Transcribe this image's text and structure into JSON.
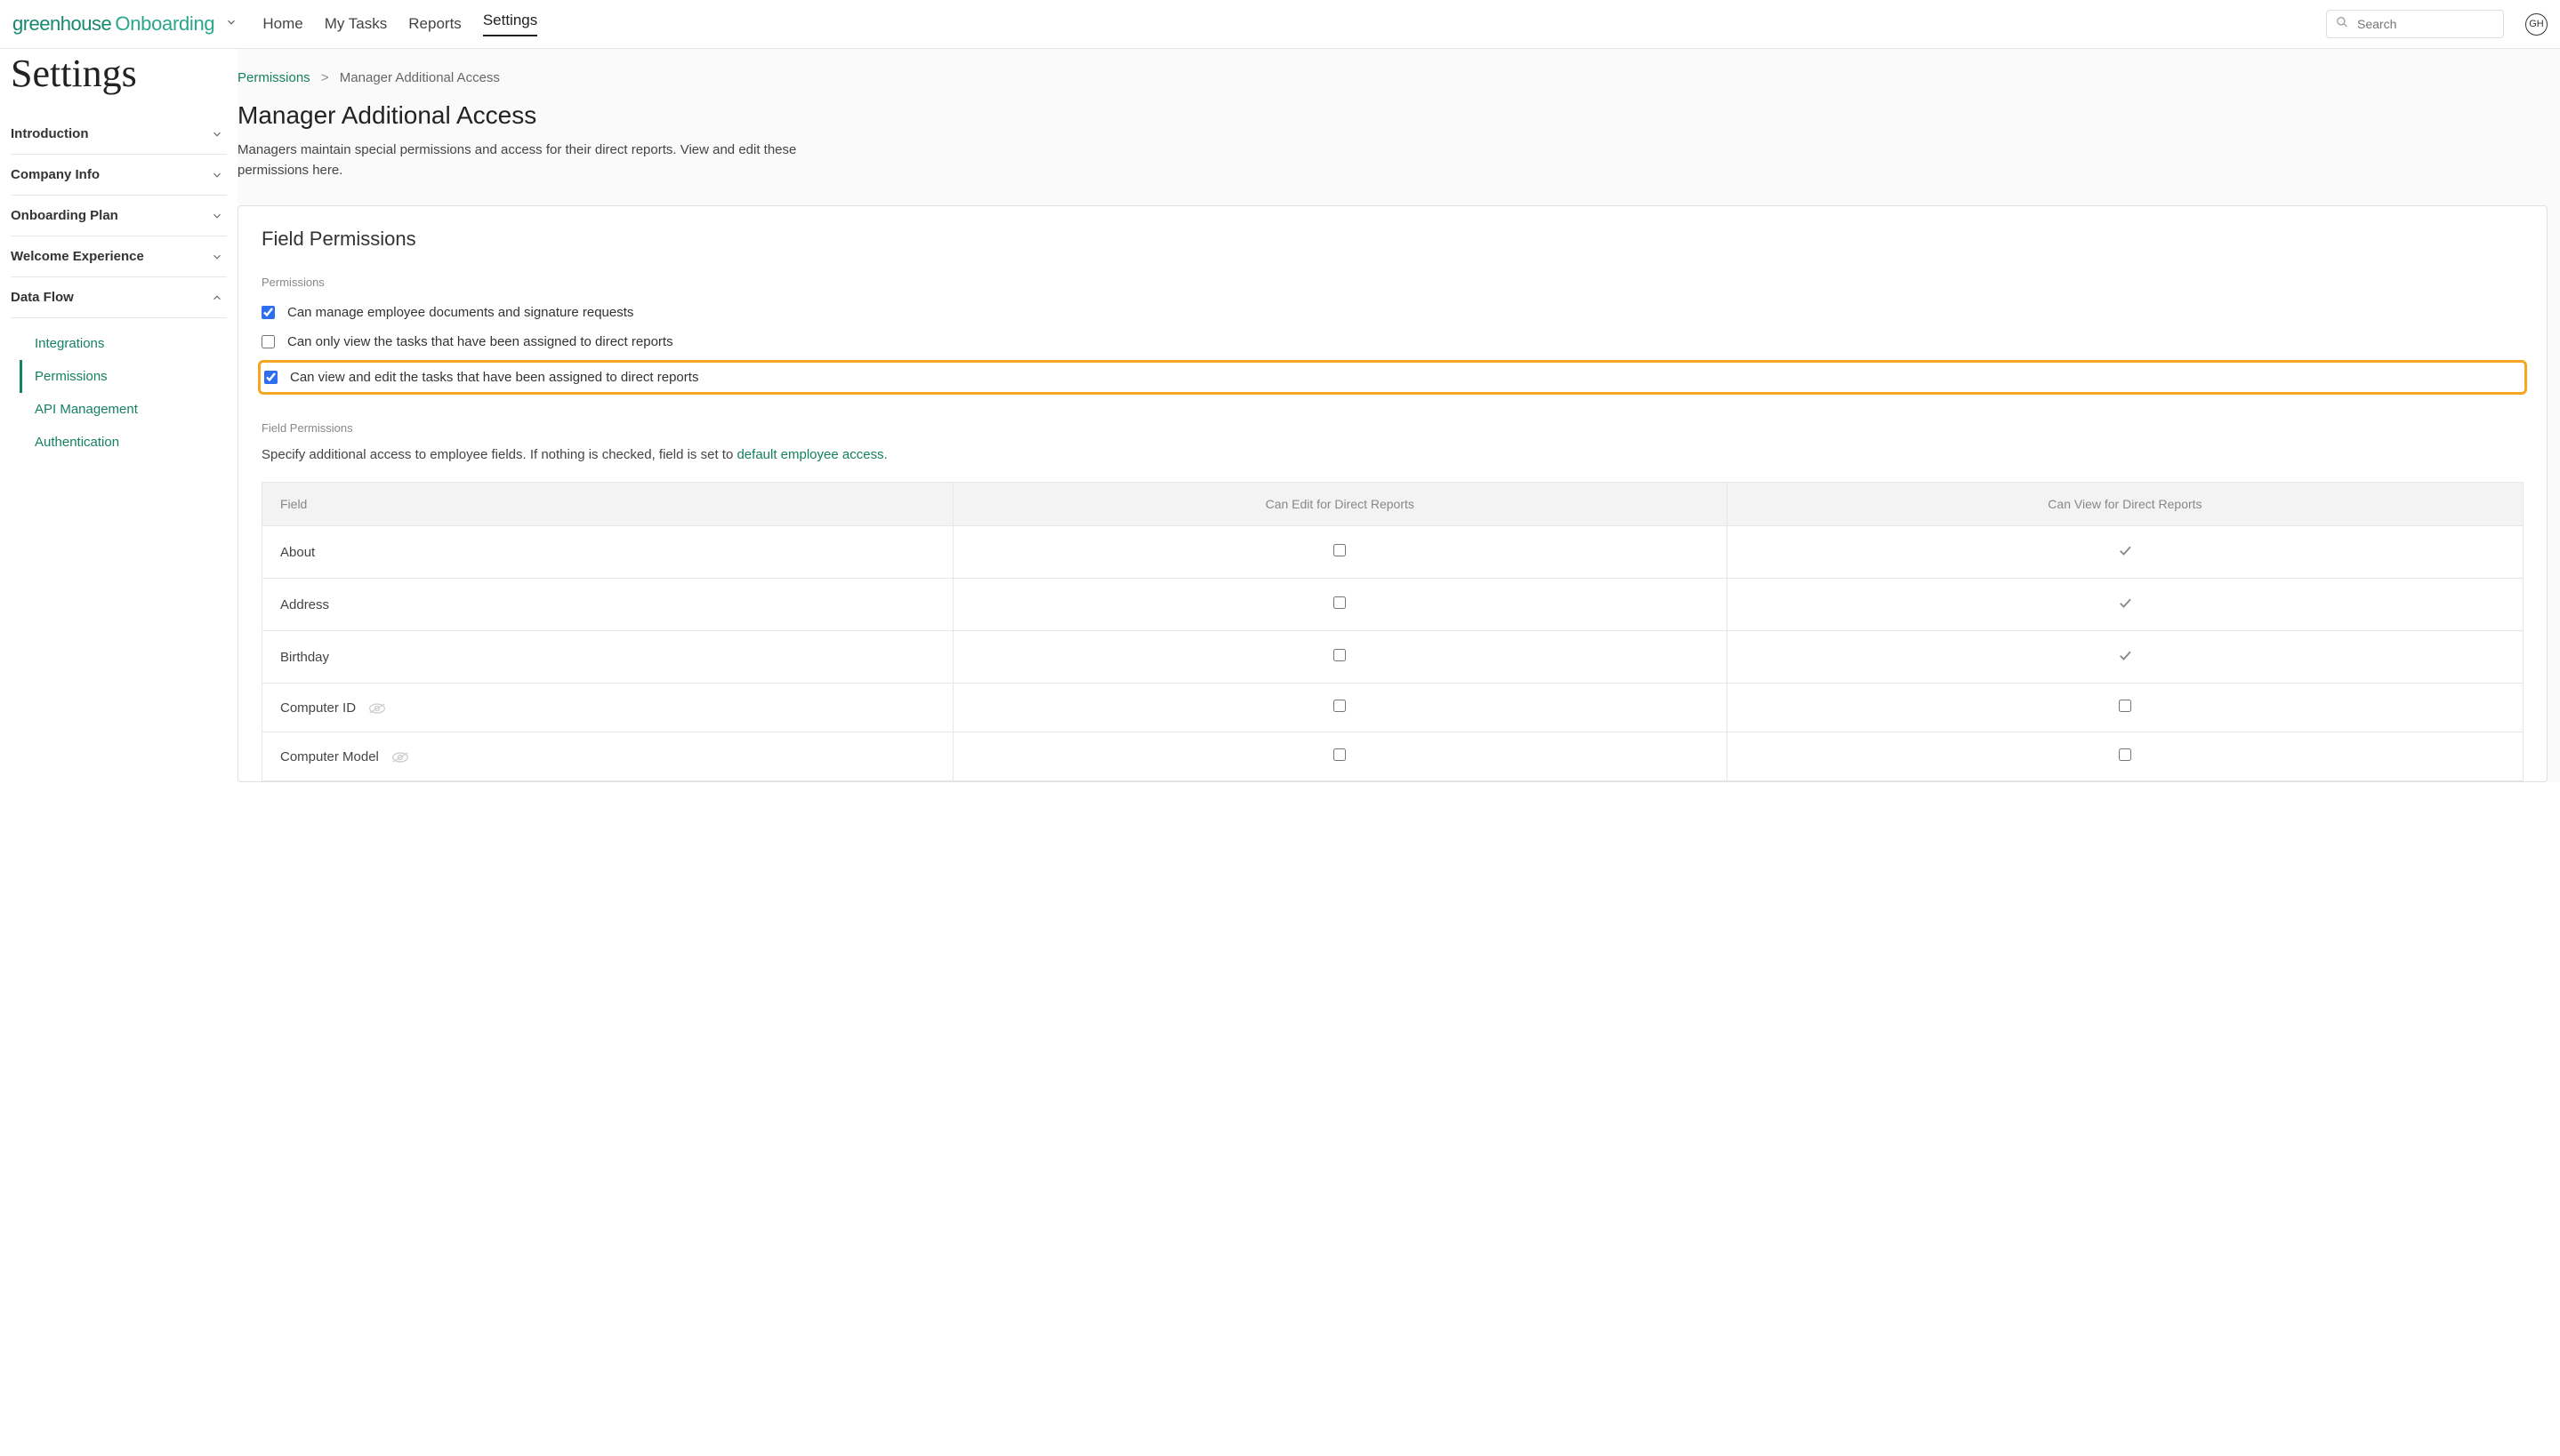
{
  "topbar": {
    "logo_primary": "greenhouse",
    "logo_secondary": "Onboarding",
    "nav": [
      "Home",
      "My Tasks",
      "Reports",
      "Settings"
    ],
    "active_nav": "Settings",
    "search_placeholder": "Search",
    "avatar_initials": "GH"
  },
  "sidebar": {
    "page_title": "Settings",
    "sections": [
      {
        "label": "Introduction",
        "expanded": false
      },
      {
        "label": "Company Info",
        "expanded": false
      },
      {
        "label": "Onboarding Plan",
        "expanded": false
      },
      {
        "label": "Welcome Experience",
        "expanded": false
      },
      {
        "label": "Data Flow",
        "expanded": true,
        "items": [
          {
            "label": "Integrations",
            "active": false
          },
          {
            "label": "Permissions",
            "active": true
          },
          {
            "label": "API Management",
            "active": false
          },
          {
            "label": "Authentication",
            "active": false
          }
        ]
      }
    ]
  },
  "breadcrumb": {
    "parent": "Permissions",
    "sep": ">",
    "current": "Manager Additional Access"
  },
  "main": {
    "title": "Manager Additional Access",
    "description": "Managers maintain special permissions and access for their direct reports. View and edit these permissions here.",
    "panel_title": "Field Permissions",
    "perm_label": "Permissions",
    "permissions": [
      {
        "label": "Can manage employee documents and signature requests",
        "checked": true,
        "highlighted": false
      },
      {
        "label": "Can only view the tasks that have been assigned to direct reports",
        "checked": false,
        "highlighted": false
      },
      {
        "label": "Can view and edit the tasks that have been assigned to direct reports",
        "checked": true,
        "highlighted": true
      }
    ],
    "field_perm_label": "Field Permissions",
    "field_desc_prefix": "Specify additional access to employee fields. If nothing is checked, field is set to ",
    "field_desc_link": "default employee access.",
    "table": {
      "headers": [
        "Field",
        "Can Edit for Direct Reports",
        "Can View for Direct Reports"
      ],
      "rows": [
        {
          "field": "About",
          "hidden_icon": false,
          "edit": false,
          "view": "check"
        },
        {
          "field": "Address",
          "hidden_icon": false,
          "edit": false,
          "view": "check"
        },
        {
          "field": "Birthday",
          "hidden_icon": false,
          "edit": false,
          "view": "check"
        },
        {
          "field": "Computer ID",
          "hidden_icon": true,
          "edit": false,
          "view": "box"
        },
        {
          "field": "Computer Model",
          "hidden_icon": true,
          "edit": false,
          "view": "box"
        }
      ]
    }
  }
}
